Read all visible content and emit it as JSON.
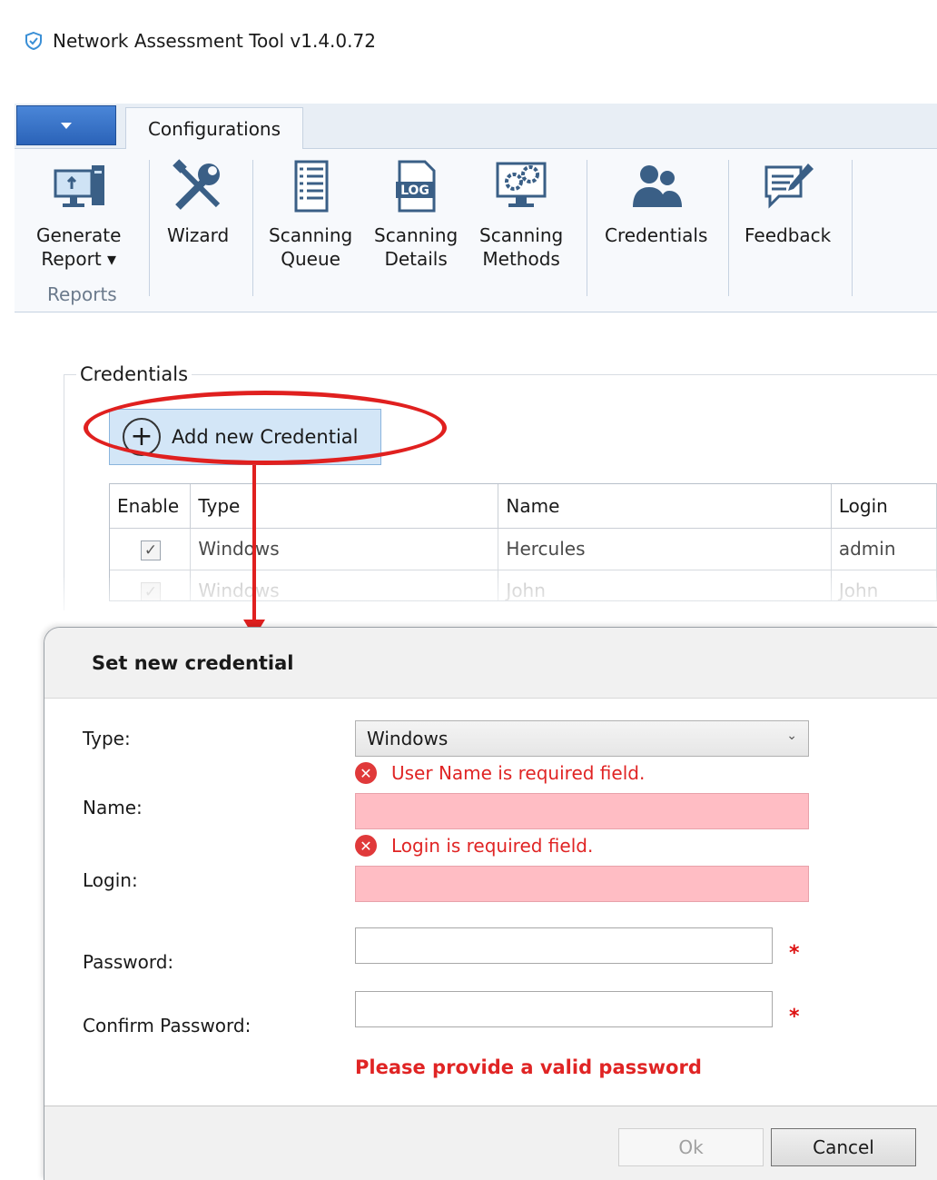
{
  "window": {
    "title": "Network Assessment Tool v1.4.0.72"
  },
  "ribbon": {
    "tab": "Configurations",
    "buttons": {
      "generate_report": [
        "Generate",
        "Report ▾"
      ],
      "wizard": "Wizard",
      "scanning_queue": [
        "Scanning",
        "Queue"
      ],
      "scanning_details": [
        "Scanning",
        "Details"
      ],
      "scanning_methods": [
        "Scanning",
        "Methods"
      ],
      "credentials": "Credentials",
      "feedback": "Feedback"
    },
    "group_reports": "Reports",
    "log_icon_text": "LOG"
  },
  "credentials_panel": {
    "section_label": "Credentials",
    "add_button": "Add new Credential",
    "columns": [
      "Enable",
      "Type",
      "Name",
      "Login"
    ],
    "rows": [
      {
        "enabled": true,
        "type": "Windows",
        "name": "Hercules",
        "login": "admin"
      },
      {
        "enabled": true,
        "type": "Windows",
        "name": "John",
        "login": "John"
      }
    ]
  },
  "dialog": {
    "title": "Set new credential",
    "labels": {
      "type": "Type:",
      "name": "Name:",
      "login": "Login:",
      "password": "Password:",
      "confirm_password": "Confirm Password:"
    },
    "type_value": "Windows",
    "errors": {
      "name": "User Name is required field.",
      "login": "Login is required field."
    },
    "required_marker": "*",
    "password_message": "Please provide a valid password",
    "buttons": {
      "ok": "Ok",
      "cancel": "Cancel"
    }
  },
  "colors": {
    "error_red": "#e02424",
    "invalid_field": "#ffbdc4",
    "annotation_red": "#e0201f",
    "ribbon_blue": "#2b63b8"
  }
}
